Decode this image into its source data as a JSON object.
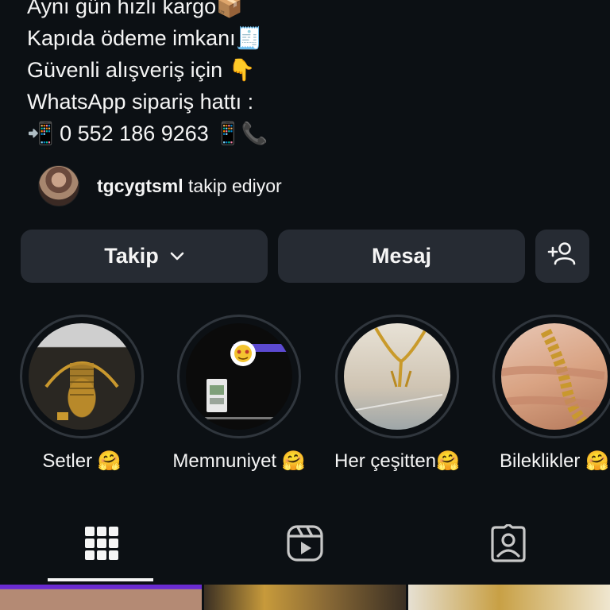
{
  "bio": {
    "lines": [
      "Aynı gün hızlı kargo📦",
      "Kapıda ödeme imkanı🧾",
      "Güvenli alışveriş için 👇",
      "WhatsApp sipariş hattı :",
      "📲 0 552 186 9263 📱📞"
    ]
  },
  "followed_by": {
    "username": "tgcygtsml",
    "text": "takip ediyor"
  },
  "actions": {
    "follow_label": "Takip",
    "message_label": "Mesaj"
  },
  "highlights": [
    {
      "label": "Setler 🤗",
      "icon": "jewelry-set-photo"
    },
    {
      "label": "Memnuniyet 🤗",
      "icon": "chat-screenshot-photo"
    },
    {
      "label": "Her çeşitten🤗",
      "icon": "necklace-photo"
    },
    {
      "label": "Bileklikler 🤗",
      "icon": "bracelet-photo"
    }
  ],
  "tabs": [
    {
      "name": "grid-icon",
      "active": true
    },
    {
      "name": "reels-icon",
      "active": false
    },
    {
      "name": "tagged-icon",
      "active": false
    }
  ],
  "colors": {
    "background": "#0c1014",
    "button": "#262b33",
    "text": "#f5f5f5"
  }
}
